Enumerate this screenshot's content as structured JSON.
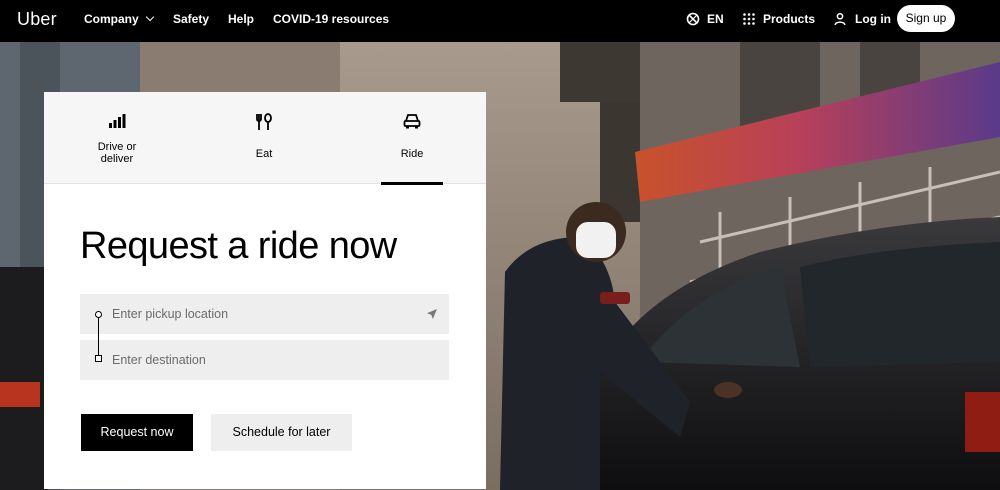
{
  "nav": {
    "logo": "Uber",
    "company": "Company",
    "safety": "Safety",
    "help": "Help",
    "covid": "COVID-19 resources",
    "language": "EN",
    "products": "Products",
    "login": "Log in",
    "signup": "Sign up"
  },
  "tabs": [
    {
      "label": "Drive or deliver",
      "icon": "signal-bars-icon"
    },
    {
      "label": "Eat",
      "icon": "fork-knife-icon"
    },
    {
      "label": "Ride",
      "icon": "car-icon",
      "active": true
    }
  ],
  "main": {
    "heading": "Request a ride now",
    "pickup_placeholder": "Enter pickup location",
    "destination_placeholder": "Enter destination",
    "request_button": "Request now",
    "schedule_button": "Schedule for later"
  },
  "colors": {
    "accent": "#000000",
    "field_bg": "#eeeeee",
    "tab_bg": "#f6f6f6"
  }
}
